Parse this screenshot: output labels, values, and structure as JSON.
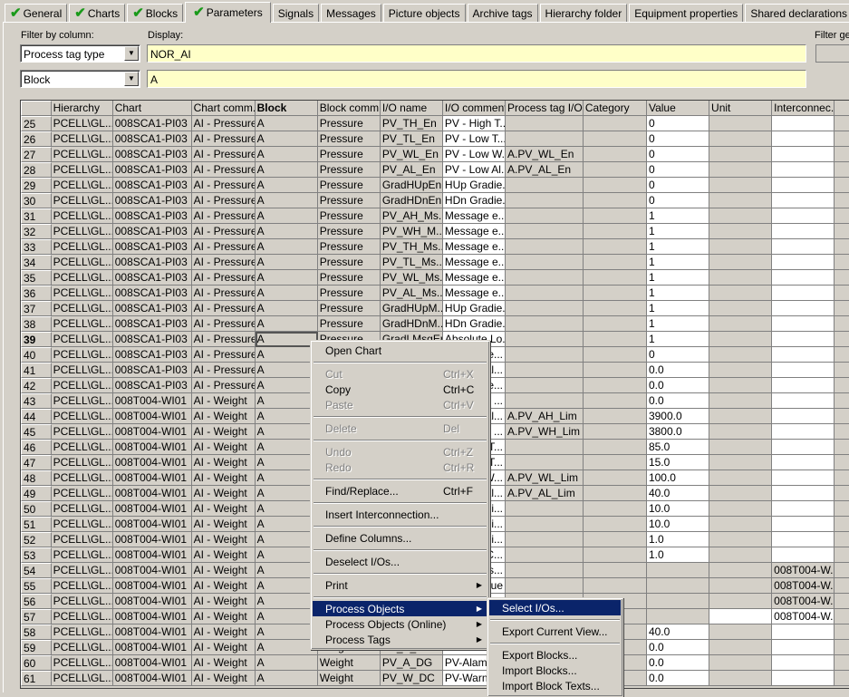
{
  "tabs": [
    {
      "label": "General",
      "checked": true
    },
    {
      "label": "Charts",
      "checked": true
    },
    {
      "label": "Blocks",
      "checked": true
    },
    {
      "label": "Parameters",
      "checked": true,
      "active": true
    },
    {
      "label": "Signals"
    },
    {
      "label": "Messages"
    },
    {
      "label": "Picture objects"
    },
    {
      "label": "Archive tags"
    },
    {
      "label": "Hierarchy folder"
    },
    {
      "label": "Equipment properties"
    },
    {
      "label": "Shared declarations"
    }
  ],
  "filter": {
    "label": "Filter by column:",
    "display_label": "Display:",
    "general_label": "Filter ge",
    "column1": "Process tag type",
    "value1": "NOR_AI",
    "column2": "Block",
    "value2": "A"
  },
  "table": {
    "columns": [
      "",
      "Hierarchy",
      "Chart",
      "Chart comm...",
      "Block",
      "Block comm...",
      "I/O name",
      "I/O comment",
      "Process tag I/O",
      "Category",
      "Value",
      "Unit",
      "Interconnec...",
      ""
    ],
    "sorted_column": "Block",
    "selected_row": "39",
    "rows": [
      [
        "25",
        "PCELL\\GL...",
        "008SCA1-PI03",
        "AI - Pressure",
        "A",
        "Pressure",
        "PV_TH_En",
        "PV - High T...",
        "",
        "",
        "0",
        "",
        ""
      ],
      [
        "26",
        "PCELL\\GL...",
        "008SCA1-PI03",
        "AI - Pressure",
        "A",
        "Pressure",
        "PV_TL_En",
        "PV - Low T...",
        "",
        "",
        "0",
        "",
        ""
      ],
      [
        "27",
        "PCELL\\GL...",
        "008SCA1-PI03",
        "AI - Pressure",
        "A",
        "Pressure",
        "PV_WL_En",
        "PV - Low W...",
        "A.PV_WL_En",
        "",
        "0",
        "",
        ""
      ],
      [
        "28",
        "PCELL\\GL...",
        "008SCA1-PI03",
        "AI - Pressure",
        "A",
        "Pressure",
        "PV_AL_En",
        "PV - Low Al...",
        "A.PV_AL_En",
        "",
        "0",
        "",
        ""
      ],
      [
        "29",
        "PCELL\\GL...",
        "008SCA1-PI03",
        "AI - Pressure",
        "A",
        "Pressure",
        "GradHUpEn",
        "HUp Gradie...",
        "",
        "",
        "0",
        "",
        ""
      ],
      [
        "30",
        "PCELL\\GL...",
        "008SCA1-PI03",
        "AI - Pressure",
        "A",
        "Pressure",
        "GradHDnEn",
        "HDn Gradie...",
        "",
        "",
        "0",
        "",
        ""
      ],
      [
        "31",
        "PCELL\\GL...",
        "008SCA1-PI03",
        "AI - Pressure",
        "A",
        "Pressure",
        "PV_AH_Ms...",
        "Message e...",
        "",
        "",
        "1",
        "",
        ""
      ],
      [
        "32",
        "PCELL\\GL...",
        "008SCA1-PI03",
        "AI - Pressure",
        "A",
        "Pressure",
        "PV_WH_M...",
        "Message e...",
        "",
        "",
        "1",
        "",
        ""
      ],
      [
        "33",
        "PCELL\\GL...",
        "008SCA1-PI03",
        "AI - Pressure",
        "A",
        "Pressure",
        "PV_TH_Ms...",
        "Message e...",
        "",
        "",
        "1",
        "",
        ""
      ],
      [
        "34",
        "PCELL\\GL...",
        "008SCA1-PI03",
        "AI - Pressure",
        "A",
        "Pressure",
        "PV_TL_Ms...",
        "Message e...",
        "",
        "",
        "1",
        "",
        ""
      ],
      [
        "35",
        "PCELL\\GL...",
        "008SCA1-PI03",
        "AI - Pressure",
        "A",
        "Pressure",
        "PV_WL_Ms...",
        "Message e...",
        "",
        "",
        "1",
        "",
        ""
      ],
      [
        "36",
        "PCELL\\GL...",
        "008SCA1-PI03",
        "AI - Pressure",
        "A",
        "Pressure",
        "PV_AL_Ms...",
        "Message e...",
        "",
        "",
        "1",
        "",
        ""
      ],
      [
        "37",
        "PCELL\\GL...",
        "008SCA1-PI03",
        "AI - Pressure",
        "A",
        "Pressure",
        "GradHUpM...",
        "HUp Gradie...",
        "",
        "",
        "1",
        "",
        ""
      ],
      [
        "38",
        "PCELL\\GL...",
        "008SCA1-PI03",
        "AI - Pressure",
        "A",
        "Pressure",
        "GradHDnM...",
        "HDn Gradie...",
        "",
        "",
        "1",
        "",
        ""
      ],
      [
        "39",
        "PCELL\\GL...",
        "008SCA1-PI03",
        "AI - Pressure",
        "A",
        "Pressure",
        "GradLMsgEn",
        "Absolute Lo...",
        "",
        "",
        "1",
        "",
        ""
      ],
      [
        "40",
        "PCELL\\GL...",
        "008SCA1-PI03",
        "AI - Pressure",
        "A",
        "",
        "",
        "ve...",
        "",
        "",
        "0",
        "",
        ""
      ],
      [
        "41",
        "PCELL\\GL...",
        "008SCA1-PI03",
        "AI - Pressure",
        "A",
        "",
        "",
        "Val...",
        "",
        "",
        "0.0",
        "",
        ""
      ],
      [
        "42",
        "PCELL\\GL...",
        "008SCA1-PI03",
        "AI - Pressure",
        "A",
        "",
        "",
        "ie...",
        "",
        "",
        "0.0",
        "",
        ""
      ],
      [
        "43",
        "PCELL\\GL...",
        "008T004-WI01",
        "AI - Weight",
        "A",
        "",
        "",
        "n ...",
        "",
        "",
        "0.0",
        "",
        ""
      ],
      [
        "44",
        "PCELL\\GL...",
        "008T004-WI01",
        "AI - Weight",
        "A",
        "",
        "",
        "Al...",
        "A.PV_AH_Lim",
        "",
        "3900.0",
        "",
        ""
      ],
      [
        "45",
        "PCELL\\GL...",
        "008T004-WI01",
        "AI - Weight",
        "A",
        "",
        "",
        "...",
        "A.PV_WH_Lim",
        "",
        "3800.0",
        "",
        ""
      ],
      [
        "46",
        "PCELL\\GL...",
        "008T004-WI01",
        "AI - Weight",
        "A",
        "",
        "",
        "T...",
        "",
        "",
        "85.0",
        "",
        ""
      ],
      [
        "47",
        "PCELL\\GL...",
        "008T004-WI01",
        "AI - Weight",
        "A",
        "",
        "",
        "T...",
        "",
        "",
        "15.0",
        "",
        ""
      ],
      [
        "48",
        "PCELL\\GL...",
        "008T004-WI01",
        "AI - Weight",
        "A",
        "",
        "",
        "W...",
        "A.PV_WL_Lim",
        "",
        "100.0",
        "",
        ""
      ],
      [
        "49",
        "PCELL\\GL...",
        "008T004-WI01",
        "AI - Weight",
        "A",
        "",
        "",
        "Al...",
        "A.PV_AL_Lim",
        "",
        "40.0",
        "",
        ""
      ],
      [
        "50",
        "PCELL\\GL...",
        "008T004-WI01",
        "AI - Weight",
        "A",
        "",
        "",
        "n li...",
        "",
        "",
        "10.0",
        "",
        ""
      ],
      [
        "51",
        "PCELL\\GL...",
        "008T004-WI01",
        "AI - Weight",
        "A",
        "",
        "",
        "n li...",
        "",
        "",
        "10.0",
        "",
        ""
      ],
      [
        "52",
        "PCELL\\GL...",
        "008T004-WI01",
        "AI - Weight",
        "A",
        "",
        "",
        "n li...",
        "",
        "",
        "1.0",
        "",
        ""
      ],
      [
        "53",
        "PCELL\\GL...",
        "008T004-WI01",
        "AI - Weight",
        "A",
        "",
        "",
        "C...",
        "",
        "",
        "1.0",
        "",
        ""
      ],
      [
        "54",
        "PCELL\\GL...",
        "008T004-WI01",
        "AI - Weight",
        "A",
        "",
        "",
        "Dis...",
        "",
        "",
        "",
        "",
        "008T004-W..."
      ],
      [
        "55",
        "PCELL\\GL...",
        "008T004-WI01",
        "AI - Weight",
        "A",
        "",
        "",
        "ue",
        "",
        "",
        "",
        "",
        "008T004-W..."
      ],
      [
        "56",
        "PCELL\\GL...",
        "008T004-WI01",
        "AI - Weight",
        "A",
        "",
        "",
        "",
        "",
        "",
        "",
        "",
        "008T004-W..."
      ],
      [
        "57",
        "PCELL\\GL...",
        "008T004-WI01",
        "AI - Weight",
        "A",
        "",
        "",
        "",
        "",
        "",
        "",
        "",
        "008T004-W..."
      ],
      [
        "58",
        "PCELL\\GL...",
        "008T004-WI01",
        "AI - Weight",
        "A",
        "",
        "",
        "",
        "",
        "",
        "40.0",
        "",
        ""
      ],
      [
        "59",
        "PCELL\\GL...",
        "008T004-WI01",
        "AI - Weight",
        "A",
        "Weight",
        "PV_A_DG",
        "",
        "",
        "",
        "0.0",
        "",
        ""
      ],
      [
        "60",
        "PCELL\\GL...",
        "008T004-WI01",
        "AI - Weight",
        "A",
        "Weight",
        "PV_A_DG",
        "PV-Alam",
        "",
        "",
        "0.0",
        "",
        ""
      ],
      [
        "61",
        "PCELL\\GL...",
        "008T004-WI01",
        "AI - Weight",
        "A",
        "Weight",
        "PV_W_DC",
        "PV-Warn",
        "",
        "",
        "0.0",
        "",
        ""
      ]
    ]
  },
  "context_menu": {
    "items": [
      {
        "label": "Open Chart"
      },
      {
        "sep": true
      },
      {
        "label": "Cut",
        "shortcut": "Ctrl+X",
        "disabled": true
      },
      {
        "label": "Copy",
        "shortcut": "Ctrl+C"
      },
      {
        "label": "Paste",
        "shortcut": "Ctrl+V",
        "disabled": true
      },
      {
        "sep": true
      },
      {
        "label": "Delete",
        "shortcut": "Del",
        "disabled": true
      },
      {
        "sep": true
      },
      {
        "label": "Undo",
        "shortcut": "Ctrl+Z",
        "disabled": true
      },
      {
        "label": "Redo",
        "shortcut": "Ctrl+R",
        "disabled": true
      },
      {
        "sep": true
      },
      {
        "label": "Find/Replace...",
        "shortcut": "Ctrl+F"
      },
      {
        "sep": true
      },
      {
        "label": "Insert Interconnection..."
      },
      {
        "sep": true
      },
      {
        "label": "Define Columns..."
      },
      {
        "sep": true
      },
      {
        "label": "Deselect I/Os..."
      },
      {
        "sep": true
      },
      {
        "label": "Print",
        "submenu": true
      },
      {
        "sep": true
      },
      {
        "label": "Process Objects",
        "submenu": true,
        "highlighted": true
      },
      {
        "label": "Process Objects (Online)",
        "submenu": true
      },
      {
        "label": "Process Tags",
        "submenu": true
      }
    ]
  },
  "submenu": {
    "items": [
      {
        "label": "Select I/Os...",
        "highlighted": true
      },
      {
        "sep": true
      },
      {
        "label": "Export Current View..."
      },
      {
        "sep": true
      },
      {
        "label": "Export Blocks..."
      },
      {
        "label": "Import Blocks..."
      },
      {
        "label": "Import Block Texts..."
      }
    ]
  },
  "colors": {
    "highlight": "#0a246a",
    "filter_input": "#ffffc8",
    "checkmark": "#1a9a1a"
  }
}
